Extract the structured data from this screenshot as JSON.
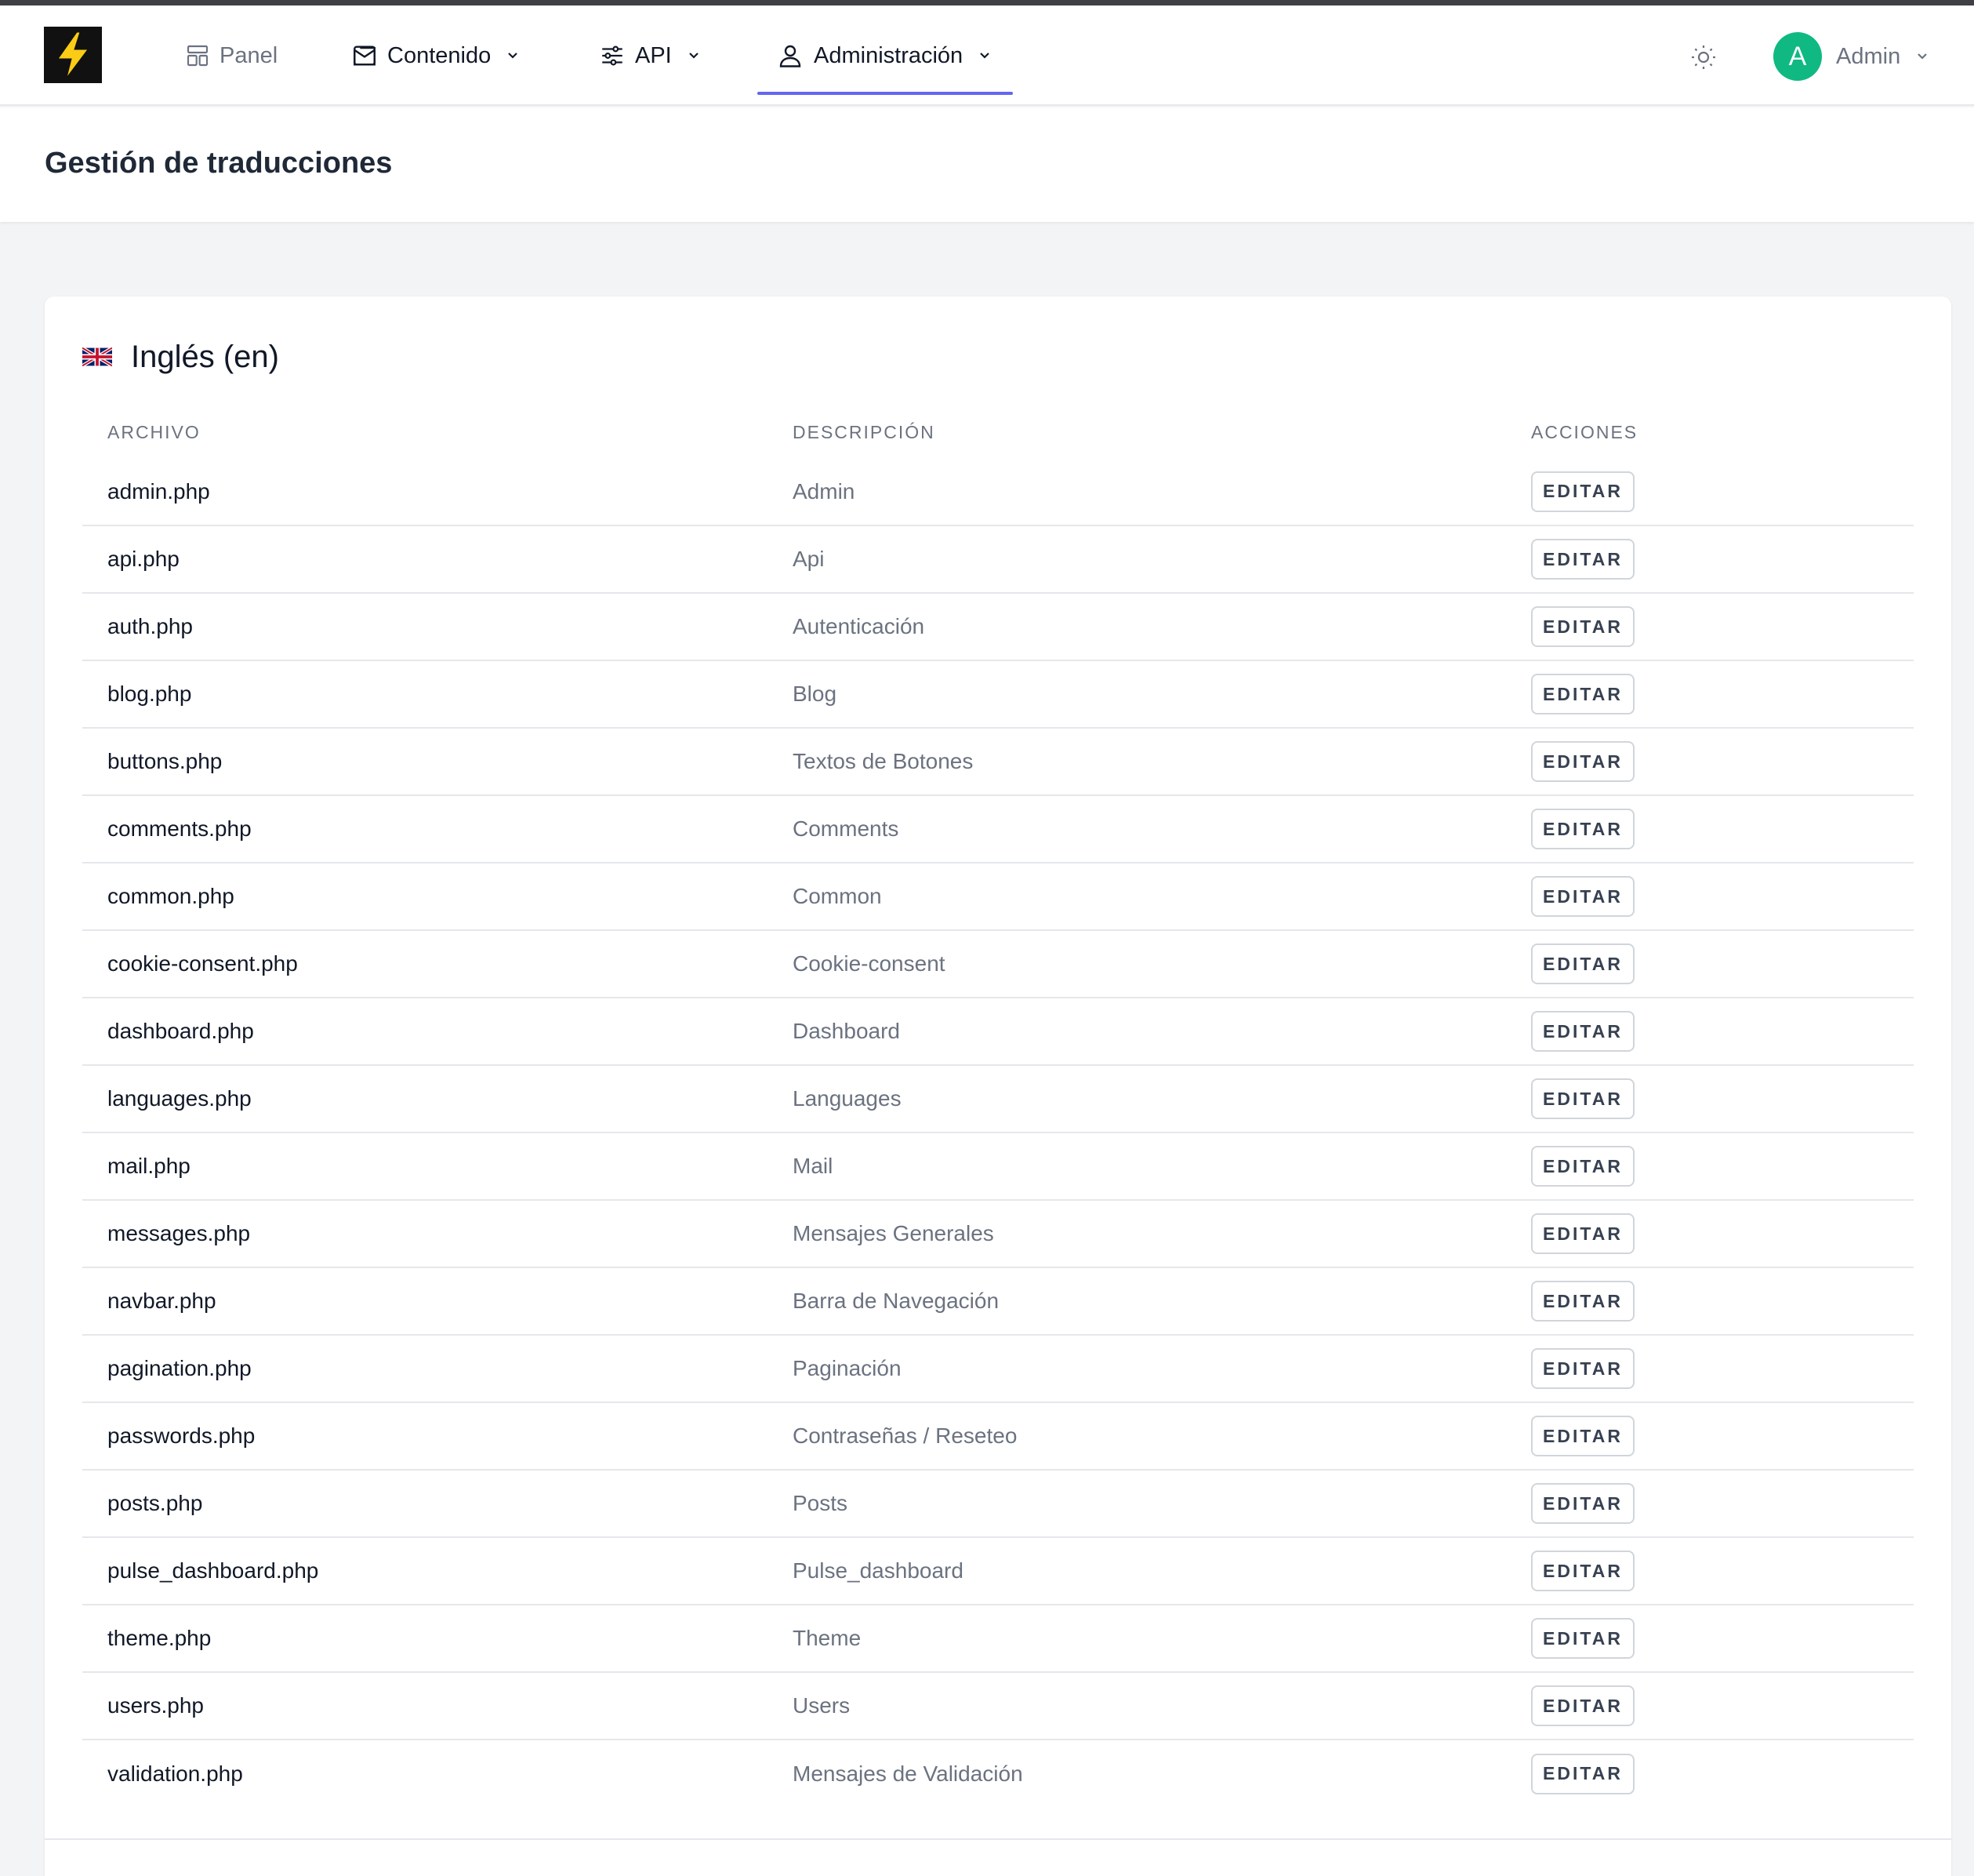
{
  "colors": {
    "accent": "#6366f1",
    "avatar_bg": "#10b981",
    "logo_bg": "#111111",
    "logo_bolt": "#facc15"
  },
  "navbar": {
    "logo_icon": "lightning-bolt-icon",
    "items": [
      {
        "label": "Panel",
        "icon": "layout-icon"
      },
      {
        "label": "Contenido",
        "icon": "newspaper-icon"
      },
      {
        "label": "API",
        "icon": "sliders-icon"
      },
      {
        "label": "Administración",
        "icon": "users-icon",
        "active": true
      }
    ],
    "theme_icon": "sun-icon",
    "user": {
      "initial": "A",
      "name": "Admin"
    }
  },
  "header": {
    "title": "Gestión de traducciones"
  },
  "section": {
    "flag_icon": "uk-flag-icon",
    "title": "Inglés (en)"
  },
  "table": {
    "columns": [
      "ARCHIVO",
      "DESCRIPCIÓN",
      "ACCIONES"
    ],
    "edit_label": "EDITAR",
    "rows": [
      {
        "file": "admin.php",
        "description": "Admin"
      },
      {
        "file": "api.php",
        "description": "Api"
      },
      {
        "file": "auth.php",
        "description": "Autenticación"
      },
      {
        "file": "blog.php",
        "description": "Blog"
      },
      {
        "file": "buttons.php",
        "description": "Textos de Botones"
      },
      {
        "file": "comments.php",
        "description": "Comments"
      },
      {
        "file": "common.php",
        "description": "Common"
      },
      {
        "file": "cookie-consent.php",
        "description": "Cookie-consent"
      },
      {
        "file": "dashboard.php",
        "description": "Dashboard"
      },
      {
        "file": "languages.php",
        "description": "Languages"
      },
      {
        "file": "mail.php",
        "description": "Mail"
      },
      {
        "file": "messages.php",
        "description": "Mensajes Generales"
      },
      {
        "file": "navbar.php",
        "description": "Barra de Navegación"
      },
      {
        "file": "pagination.php",
        "description": "Paginación"
      },
      {
        "file": "passwords.php",
        "description": "Contraseñas / Reseteo"
      },
      {
        "file": "posts.php",
        "description": "Posts"
      },
      {
        "file": "pulse_dashboard.php",
        "description": "Pulse_dashboard"
      },
      {
        "file": "theme.php",
        "description": "Theme"
      },
      {
        "file": "users.php",
        "description": "Users"
      },
      {
        "file": "validation.php",
        "description": "Mensajes de Validación"
      }
    ]
  }
}
